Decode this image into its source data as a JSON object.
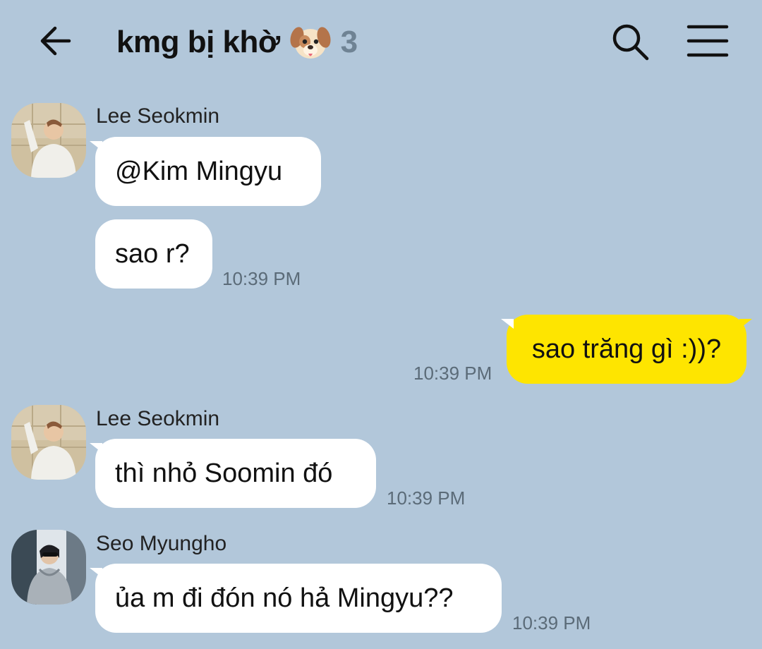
{
  "header": {
    "title": "kmg bị khờ",
    "title_emoji": "dog-face-emoji",
    "member_count": "3",
    "back_icon": "back-arrow-icon",
    "search_icon": "search-icon",
    "menu_icon": "menu-icon"
  },
  "colors": {
    "background": "#b2c7da",
    "incoming_bubble": "#ffffff",
    "outgoing_bubble": "#fee500",
    "timestamp": "#5b6b78"
  },
  "messages": [
    {
      "sender": "Lee Seokmin",
      "text": "@Kim Mingyu",
      "time": ""
    },
    {
      "sender": "Lee Seokmin",
      "text": "sao r?",
      "time": "10:39 PM"
    },
    {
      "sender": "me",
      "text": "sao trăng gì :))?",
      "time": "10:39 PM"
    },
    {
      "sender": "Lee Seokmin",
      "text": "thì nhỏ Soomin đó",
      "time": "10:39 PM"
    },
    {
      "sender": "Seo Myungho",
      "text": "ủa m đi đón nó hả Mingyu??",
      "time": "10:39 PM"
    }
  ]
}
